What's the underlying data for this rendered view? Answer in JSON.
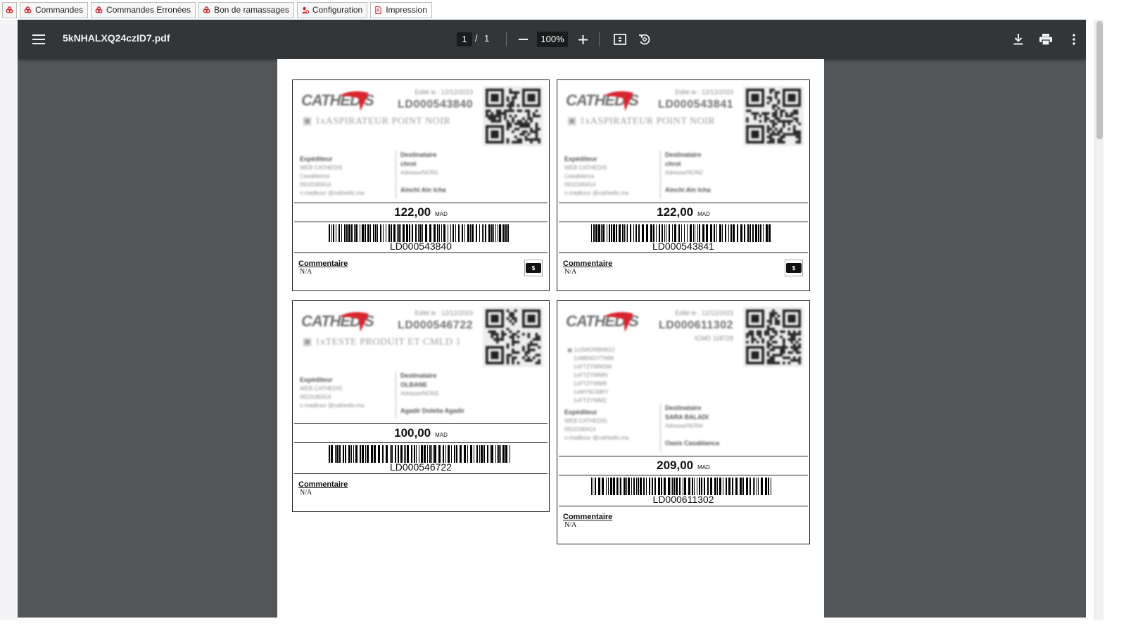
{
  "app_tabs": [
    {
      "label": "",
      "icon": "users-red-icon"
    },
    {
      "label": "Commandes",
      "icon": "users-red-icon"
    },
    {
      "label": "Commandes Erronées",
      "icon": "users-red-icon"
    },
    {
      "label": "Bon de ramassages",
      "icon": "users-red-icon"
    },
    {
      "label": "Configuration",
      "icon": "user-gear-red-icon"
    },
    {
      "label": "Impression",
      "icon": "pdf-red-icon"
    }
  ],
  "viewer": {
    "file_name": "5kNHALXQ24czID7.pdf",
    "page_current": "1",
    "page_separator": "/",
    "page_total": "1",
    "zoom": "100%",
    "colors": {
      "toolbar": "#323639",
      "background": "#525659",
      "brand_red": "#d9232d"
    }
  },
  "labels": [
    {
      "brand": "CATHEDIS",
      "date": "Edité le : 12/12/2023",
      "tracking_blurred": "LD000543840",
      "product": "1xASPIRATEUR POINT NOIR",
      "sender_title": "Expéditeur",
      "sender_lines": [
        "WEB CATHEDIS",
        "Casablanca",
        "0610180414",
        "n.madkour @cathedis.ma"
      ],
      "recipient_title": "Destinataire",
      "recipient_lines": [
        "chrot",
        "Adresse/NON1",
        "Ainchi Ain Icha"
      ],
      "price": "122,00",
      "currency": "MAD",
      "barcode_text": "LD000543840",
      "comment_title": "Commentaire",
      "comment_value": "N/A",
      "cash_icon": "$",
      "has_cash_icon": true
    },
    {
      "brand": "CATHEDIS",
      "date": "Edité le : 12/12/2023",
      "tracking_blurred": "LD000543841",
      "product": "1xASPIRATEUR POINT NOIR",
      "sender_title": "Expéditeur",
      "sender_lines": [
        "WEB CATHEDIS",
        "Casablanca",
        "0610180414",
        "n.madkour @cathedis.ma"
      ],
      "recipient_title": "Destinataire",
      "recipient_lines": [
        "chrot",
        "Adresse/NON2",
        "Ainchi Ain Icha"
      ],
      "price": "122,00",
      "currency": "MAD",
      "barcode_text": "LD000543841",
      "comment_title": "Commentaire",
      "comment_value": "N/A",
      "cash_icon": "$",
      "has_cash_icon": true
    },
    {
      "brand": "CATHEDIS",
      "date": "Edité le : 12/12/2023",
      "tracking_blurred": "LD000546722",
      "product": "1xTESTE PRODUIT ET CMLD 1",
      "sender_title": "Expéditeur",
      "sender_lines": [
        "WEB CATHEDIS",
        "0610180414",
        "n.madkour @cathedis.ma"
      ],
      "recipient_title": "Destinataire",
      "recipient_lines": [
        "OLBANE",
        "Adresse/NON3",
        "Agadir Dolelia Agadir"
      ],
      "price": "100,00",
      "currency": "MAD",
      "barcode_text": "LD000546722",
      "comment_title": "Commentaire",
      "comment_value": "N/A",
      "has_cash_icon": false
    },
    {
      "brand": "CATHEDIS",
      "date": "Edité le : 12/12/2023",
      "tracking_blurred": "LD000611302",
      "sub_code": "ICMD 118728",
      "product_lines": [
        "1xSMGRBM612",
        "1xMBNGYTWM",
        "1xFTZYWM3W",
        "1xFTZYWMN",
        "1xFTZYWM9",
        "1xMYNCMRY",
        "1xFTZYWM2"
      ],
      "sender_title": "Expéditeur",
      "sender_lines": [
        "WEB CATHEDIS",
        "0610180414",
        "n.madkour @cathedis.ma"
      ],
      "recipient_title": "Destinataire",
      "recipient_lines": [
        "SARA BALADI",
        "Adresse/NON4",
        "Oasis Casablanca"
      ],
      "price": "209,00",
      "currency": "MAD",
      "barcode_text": "LD000611302",
      "comment_title": "Commentaire",
      "comment_value": "N/A",
      "has_cash_icon": false
    }
  ]
}
